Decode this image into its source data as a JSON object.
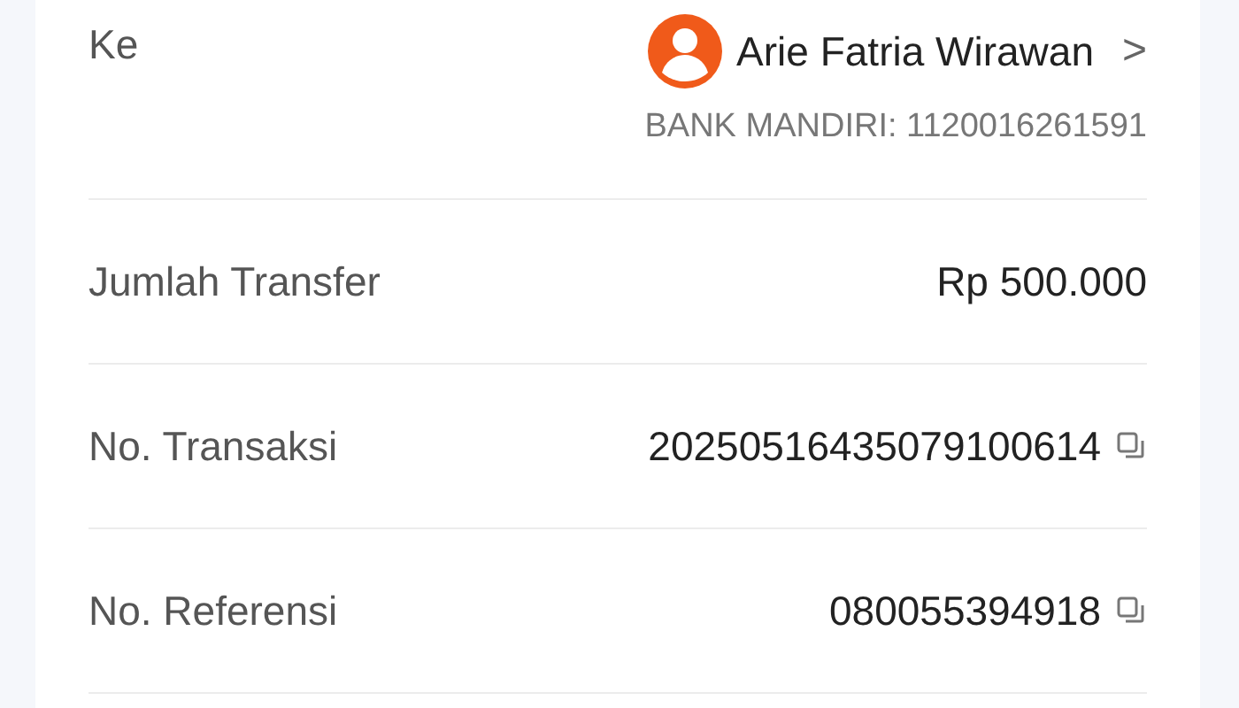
{
  "rows": [
    {
      "kind": "recipient",
      "label": "Ke",
      "name": "Arie Fatria Wirawan",
      "chevron": ">",
      "account": "BANK MANDIRI: 1120016261591"
    },
    {
      "kind": "plain",
      "label": "Jumlah Transfer",
      "value": "Rp 500.000"
    },
    {
      "kind": "copyable",
      "label": "No. Transaksi",
      "value": "20250516435079100614"
    },
    {
      "kind": "copyable",
      "label": "No. Referensi",
      "value": "080055394918"
    }
  ]
}
